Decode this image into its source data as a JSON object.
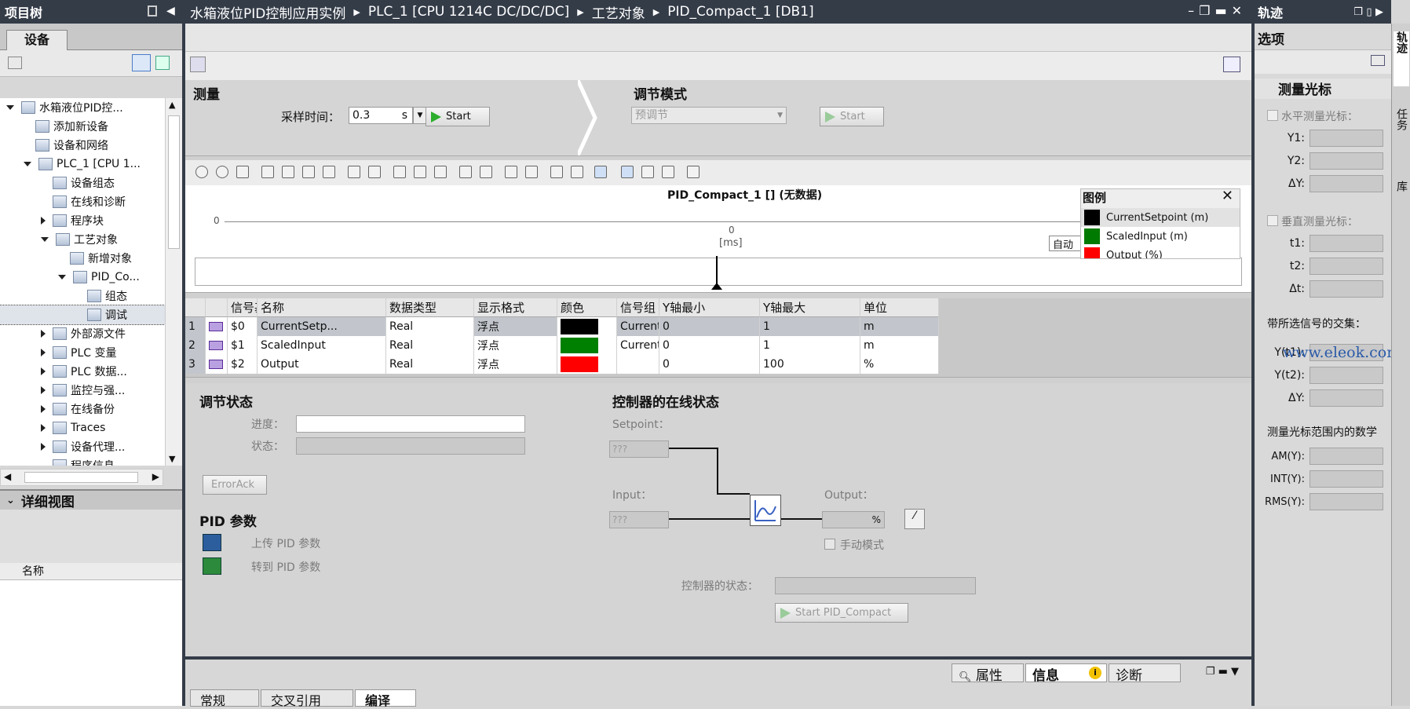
{
  "left_panel": {
    "title": "项目树",
    "tab": "设备",
    "detail_title": "详细视图",
    "detail_col": "名称"
  },
  "tree": [
    {
      "label": "水箱液位PID控...",
      "indent": 0,
      "exp": "d"
    },
    {
      "label": "添加新设备",
      "indent": 1,
      "exp": ""
    },
    {
      "label": "设备和网络",
      "indent": 1,
      "exp": ""
    },
    {
      "label": "PLC_1 [CPU 1...",
      "indent": 1,
      "exp": "d"
    },
    {
      "label": "设备组态",
      "indent": 2,
      "exp": ""
    },
    {
      "label": "在线和诊断",
      "indent": 2,
      "exp": ""
    },
    {
      "label": "程序块",
      "indent": 2,
      "exp": "r"
    },
    {
      "label": "工艺对象",
      "indent": 2,
      "exp": "d"
    },
    {
      "label": "新增对象",
      "indent": 3,
      "exp": ""
    },
    {
      "label": "PID_Co...",
      "indent": 3,
      "exp": "d"
    },
    {
      "label": "组态",
      "indent": 4,
      "exp": ""
    },
    {
      "label": "调试",
      "indent": 4,
      "exp": "",
      "selected": true
    },
    {
      "label": "外部源文件",
      "indent": 2,
      "exp": "r"
    },
    {
      "label": "PLC 变量",
      "indent": 2,
      "exp": "r"
    },
    {
      "label": "PLC 数据...",
      "indent": 2,
      "exp": "r"
    },
    {
      "label": "监控与强...",
      "indent": 2,
      "exp": "r"
    },
    {
      "label": "在线备份",
      "indent": 2,
      "exp": "r"
    },
    {
      "label": "Traces",
      "indent": 2,
      "exp": "r"
    },
    {
      "label": "设备代理...",
      "indent": 2,
      "exp": "r"
    },
    {
      "label": "程序信息",
      "indent": 2,
      "exp": ""
    }
  ],
  "breadcrumb": [
    "水箱液位PID控制应用实例",
    "PLC_1 [CPU 1214C DC/DC/DC]",
    "工艺对象",
    "PID_Compact_1 [DB1]"
  ],
  "measure": {
    "title": "测量",
    "sample_label": "采样时间：",
    "sample_value": "0.3",
    "unit": "s",
    "start": "Start"
  },
  "tuning": {
    "title": "调节模式",
    "mode": "预调节",
    "start": "Start"
  },
  "chart": {
    "title": "PID_Compact_1 [] (无数据)",
    "y0": "0",
    "x0": "0",
    "xunit": "[ms]",
    "auto": "自动"
  },
  "legend": {
    "title": "图例",
    "items": [
      {
        "label": "CurrentSetpoint (m)",
        "color": "#000000"
      },
      {
        "label": "ScaledInput (m)",
        "color": "#007a00"
      },
      {
        "label": "Output (%)",
        "color": "#ff0000"
      }
    ]
  },
  "table": {
    "headers": [
      "",
      "",
      "信号基...",
      "名称",
      "数据类型",
      "显示格式",
      "颜色",
      "信号组",
      "Y轴最小",
      "Y轴最大",
      "单位"
    ],
    "rows": [
      {
        "n": "1",
        "addr": "$0",
        "name": "CurrentSetp...",
        "type": "Real",
        "fmt": "浮点",
        "color": "#000000",
        "group": "CurrentSetp...",
        "ymin": "0",
        "ymax": "1",
        "unit": "m"
      },
      {
        "n": "2",
        "addr": "$1",
        "name": "ScaledInput",
        "type": "Real",
        "fmt": "浮点",
        "color": "#008000",
        "group": "CurrentSetpoint...",
        "ymin": "0",
        "ymax": "1",
        "unit": "m"
      },
      {
        "n": "3",
        "addr": "$2",
        "name": "Output",
        "type": "Real",
        "fmt": "浮点",
        "color": "#ff0000",
        "group": "",
        "ymin": "0",
        "ymax": "100",
        "unit": "%"
      }
    ]
  },
  "tuning_status": {
    "title": "调节状态",
    "progress": "进度：",
    "status": "状态：",
    "errorack": "ErrorAck"
  },
  "pid_params": {
    "title": "PID 参数",
    "upload": "上传 PID 参数",
    "goto": "转到 PID 参数"
  },
  "online": {
    "title": "控制器的在线状态",
    "setpoint": "Setpoint：",
    "input": "Input：",
    "output": "Output：",
    "sp_val": "???",
    "in_val": "???",
    "pct": "%",
    "manual": "手动模式",
    "ctrl_state": "控制器的状态：",
    "start": "Start PID_Compact"
  },
  "bottom_tabs": {
    "props": "属性",
    "info": "信息",
    "diag": "诊断",
    "t1": "常规",
    "t2": "交叉引用",
    "t3": "编译"
  },
  "right": {
    "title": "轨迹",
    "options": "选项",
    "cursor": "测量光标",
    "hcursor": "水平测量光标：",
    "y1": "Y1:",
    "y2": "Y2:",
    "dy": "ΔY:",
    "vcursor": "垂直测量光标：",
    "t1": "t1:",
    "t2": "t2:",
    "dt": "Δt:",
    "inter": "带所选信号的交集：",
    "yt1": "Y(t1):",
    "yt2": "Y(t2):",
    "dy2": "ΔY:",
    "range": "测量光标范围内的数学",
    "am": "AM(Y):",
    "int": "INT(Y):",
    "rms": "RMS(Y):",
    "vt1": "轨迹",
    "vt2": "任务",
    "vt3": "库"
  },
  "watermark": "www.eleok.com"
}
